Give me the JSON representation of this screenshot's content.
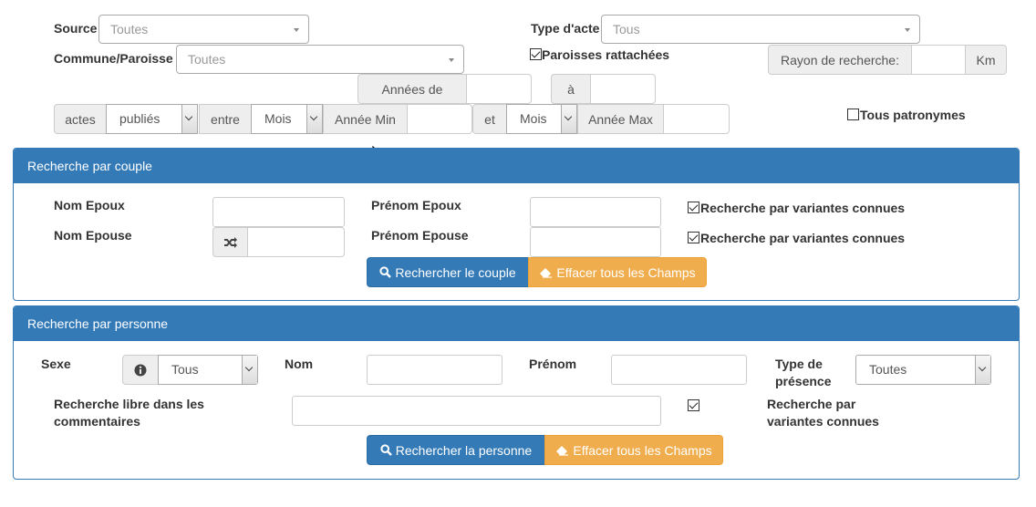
{
  "filters": {
    "source_label": "Source",
    "source_value": "Toutes",
    "type_acte_label": "Type d'acte",
    "type_acte_value": "Tous",
    "commune_label": "Commune/Paroisse",
    "commune_value": "Toutes",
    "paroisses_label": "Paroisses rattachées",
    "paroisses_checked": true,
    "rayon_label": "Rayon de recherche:",
    "rayon_unit": "Km",
    "annees_de_label": "Années de",
    "annees_a_label": "à",
    "actes_label": "actes",
    "actes_status": "publiés",
    "entre_label": "entre",
    "mois_min": "Mois",
    "annee_min_label": "Année Min",
    "et_label": "et",
    "mois_max": "Mois",
    "annee_max_label": "Année Max",
    "tous_patronymes_label": "Tous patronymes",
    "tous_patronymes_checked": false
  },
  "couple_panel": {
    "title": "Recherche par couple",
    "nom_epoux_label": "Nom Epoux",
    "nom_epouse_label": "Nom Epouse",
    "prenom_epoux_label": "Prénom Epoux",
    "prenom_epouse_label": "Prénom Epouse",
    "variantes_label_1": "Recherche par variantes connues",
    "variantes_label_2": "Recherche par variantes connues",
    "search_button": "Rechercher le couple",
    "clear_button": "Effacer tous les Champs"
  },
  "personne_panel": {
    "title": "Recherche par personne",
    "sexe_label": "Sexe",
    "sexe_value": "Tous",
    "nom_label": "Nom",
    "prenom_label": "Prénom",
    "type_presence_label_1": "Type de",
    "type_presence_label_2": "présence",
    "type_presence_value": "Toutes",
    "libre_label_1": "Recherche libre dans les",
    "libre_label_2": "commentaires",
    "variantes_label_1": "Recherche par",
    "variantes_label_2": "variantes connues",
    "search_button": "Rechercher la personne",
    "clear_button": "Effacer tous les Champs"
  },
  "colors": {
    "primary": "#337ab7",
    "warning": "#f0ad4e"
  }
}
